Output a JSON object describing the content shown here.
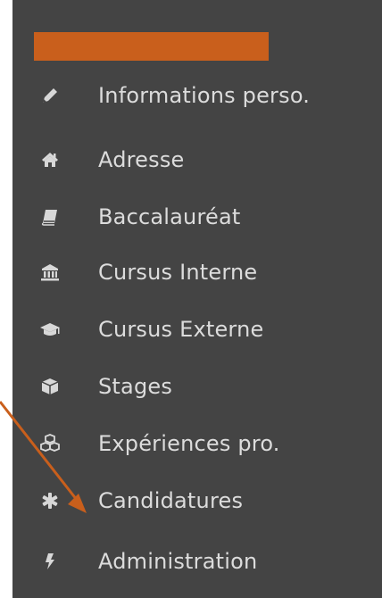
{
  "sidebar": {
    "header_color": "#c95f1c",
    "items": [
      {
        "label": "Informations perso.",
        "icon": "pencil-icon"
      },
      {
        "label": "Adresse",
        "icon": "home-icon"
      },
      {
        "label": "Baccalauréat",
        "icon": "book-icon"
      },
      {
        "label": "Cursus Interne",
        "icon": "bank-icon"
      },
      {
        "label": "Cursus Externe",
        "icon": "graduation-cap-icon"
      },
      {
        "label": "Stages",
        "icon": "cube-icon"
      },
      {
        "label": "Expériences pro.",
        "icon": "cubes-icon"
      },
      {
        "label": "Candidatures",
        "icon": "asterisk-icon"
      },
      {
        "label": "Administration",
        "icon": "bolt-icon"
      }
    ]
  },
  "annotation": {
    "arrow_color": "#c95f1c",
    "points_to": "Candidatures"
  }
}
